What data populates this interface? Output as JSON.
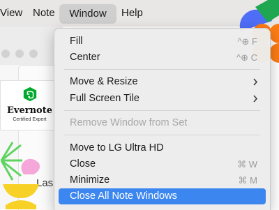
{
  "menubar": {
    "items": [
      "View",
      "Note",
      "Window",
      "Help"
    ]
  },
  "background": {
    "partial_label": "Las"
  },
  "badge": {
    "title": "Evernote",
    "subtitle": "Certified Expert",
    "brand_color": "#00a82d"
  },
  "menu": {
    "items": [
      {
        "label": "Fill",
        "shortcut": "^⊕ F"
      },
      {
        "label": "Center",
        "shortcut": "^⊕ C"
      },
      {
        "label": "Move & Resize",
        "submenu": true
      },
      {
        "label": "Full Screen Tile",
        "submenu": true
      },
      {
        "label": "Remove Window from Set",
        "disabled": true
      },
      {
        "label": "Move to LG Ultra HD"
      },
      {
        "label": "Close",
        "shortcut": "⌘ W"
      },
      {
        "label": "Minimize",
        "shortcut": "⌘ M"
      },
      {
        "label": "Close All Note Windows",
        "highlighted": true
      }
    ],
    "highlight_color": "#3c86f0"
  }
}
